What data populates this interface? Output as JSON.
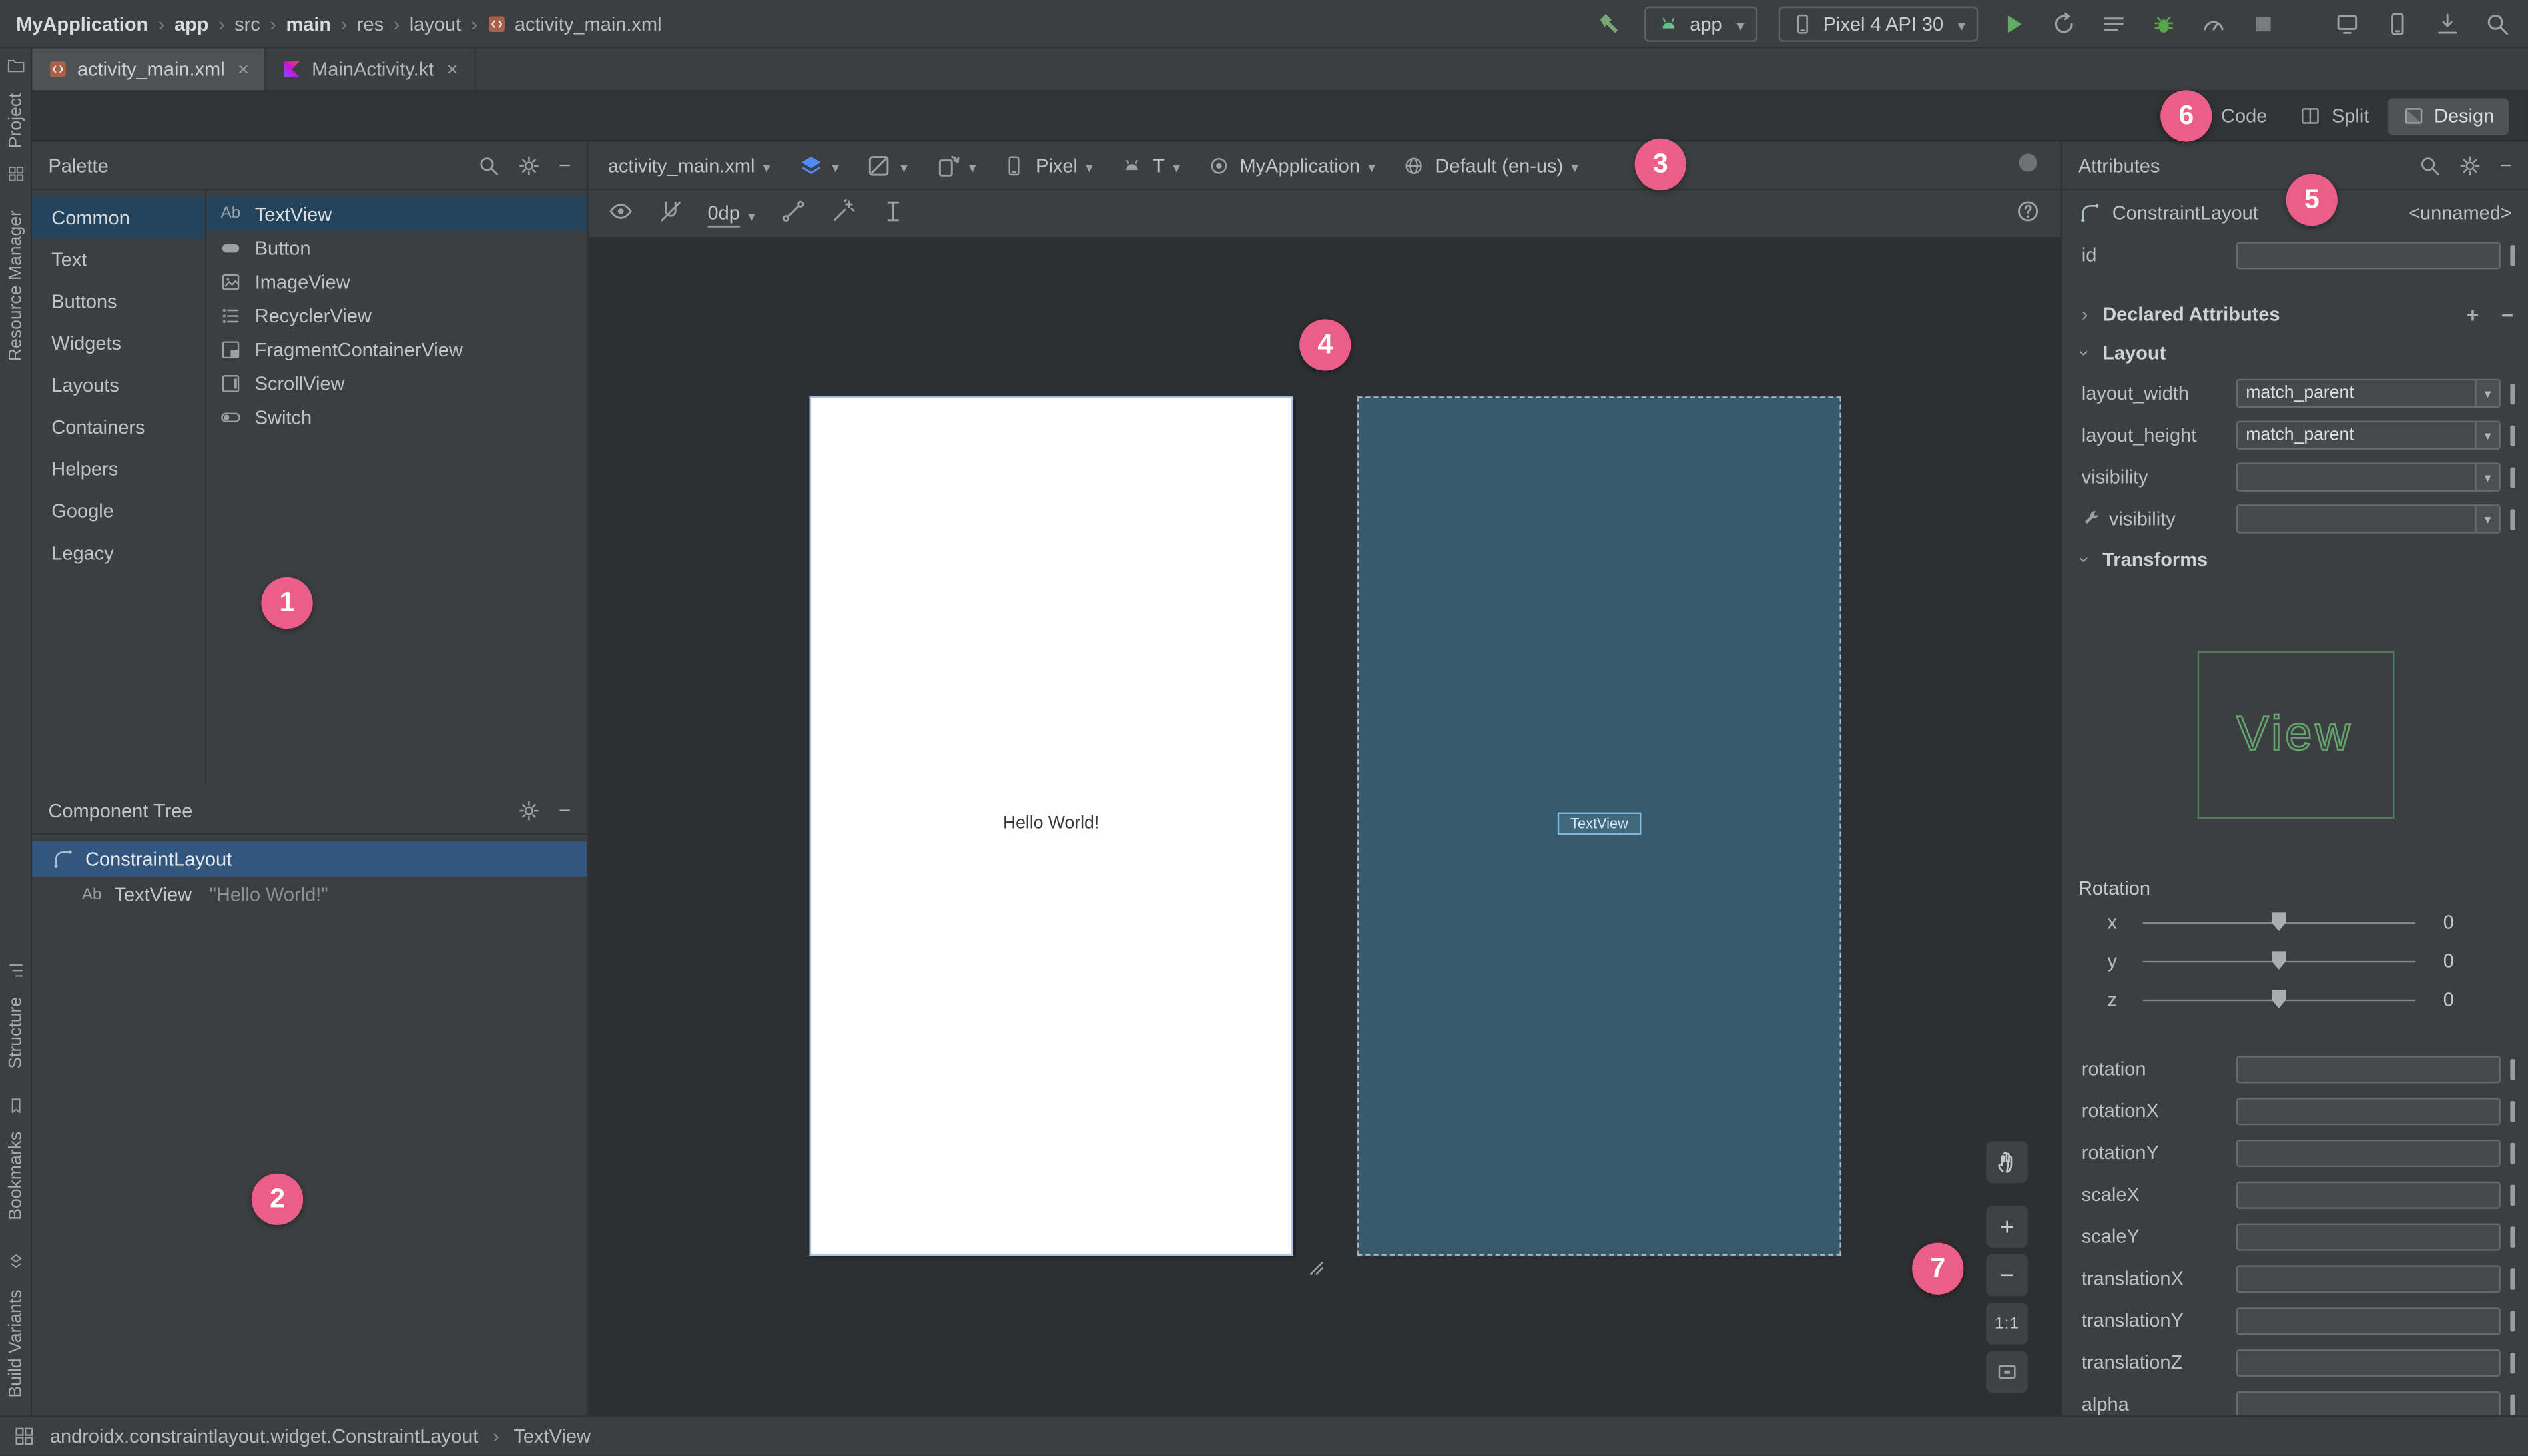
{
  "colors": {
    "badge": "#ec5e8a",
    "selection": "#24435c",
    "tree_selection": "#33567f",
    "blueprint": "#36596c",
    "accent_green": "#62ab45",
    "panel_bg": "#3c3f41"
  },
  "topbar": {
    "breadcrumb": [
      "MyApplication",
      "app",
      "src",
      "main",
      "res",
      "layout",
      "activity_main.xml"
    ],
    "run_config": "app",
    "device": "Pixel 4 API 30"
  },
  "tabs": {
    "tab1": "activity_main.xml",
    "tab2": "MainActivity.kt",
    "close": "×"
  },
  "view_toggle": {
    "code": "Code",
    "split": "Split",
    "design": "Design"
  },
  "tool_windows": {
    "project": "Project",
    "resource_manager": "Resource Manager",
    "structure": "Structure",
    "bookmarks": "Bookmarks",
    "build_variants": "Build Variants"
  },
  "palette": {
    "title": "Palette",
    "categories": [
      "Common",
      "Text",
      "Buttons",
      "Widgets",
      "Layouts",
      "Containers",
      "Helpers",
      "Google",
      "Legacy"
    ],
    "components": [
      {
        "icon": "Ab",
        "label": "TextView"
      },
      {
        "label": "Button"
      },
      {
        "label": "ImageView"
      },
      {
        "label": "RecyclerView"
      },
      {
        "label": "FragmentContainerView"
      },
      {
        "label": "ScrollView"
      },
      {
        "label": "Switch"
      }
    ]
  },
  "component_tree": {
    "title": "Component Tree",
    "root": {
      "label": "ConstraintLayout"
    },
    "child": {
      "icon": "Ab",
      "label": "TextView",
      "value": "\"Hello World!\""
    }
  },
  "design_toolbar": {
    "file": "activity_main.xml",
    "device": "Pixel",
    "api": "T",
    "theme": "MyApplication",
    "locale": "Default (en-us)",
    "default_margin": "0dp"
  },
  "canvas": {
    "design_text": "Hello World!",
    "blueprint_component": "TextView"
  },
  "zoom_controls": {
    "zoom_in": "+",
    "zoom_out": "−",
    "ratio": "1:1"
  },
  "attributes": {
    "title": "Attributes",
    "component": "ConstraintLayout",
    "component_id": "<unnamed>",
    "id_label": "id",
    "declared_section": "Declared Attributes",
    "layout_section": "Layout",
    "rows": {
      "layout_width": {
        "label": "layout_width",
        "value": "match_parent"
      },
      "layout_height": {
        "label": "layout_height",
        "value": "match_parent"
      },
      "visibility": {
        "label": "visibility",
        "value": ""
      },
      "tools_visibility": {
        "label": "visibility",
        "value": ""
      }
    },
    "transforms_section": "Transforms",
    "view_preview": "View",
    "rotation_label": "Rotation",
    "sliders": [
      {
        "axis": "x",
        "value": "0"
      },
      {
        "axis": "y",
        "value": "0"
      },
      {
        "axis": "z",
        "value": "0"
      }
    ],
    "fields": [
      {
        "label": "rotation",
        "value": ""
      },
      {
        "label": "rotationX",
        "value": ""
      },
      {
        "label": "rotationY",
        "value": ""
      },
      {
        "label": "scaleX",
        "value": ""
      },
      {
        "label": "scaleY",
        "value": ""
      },
      {
        "label": "translationX",
        "value": ""
      },
      {
        "label": "translationY",
        "value": ""
      },
      {
        "label": "translationZ",
        "value": ""
      },
      {
        "label": "alpha",
        "value": ""
      }
    ]
  },
  "status_bar": {
    "class_path": "androidx.constraintlayout.widget.ConstraintLayout",
    "selected": "TextView"
  },
  "annotations": [
    {
      "label": "1"
    },
    {
      "label": "2"
    },
    {
      "label": "3"
    },
    {
      "label": "4"
    },
    {
      "label": "5"
    },
    {
      "label": "6"
    },
    {
      "label": "7"
    }
  ]
}
